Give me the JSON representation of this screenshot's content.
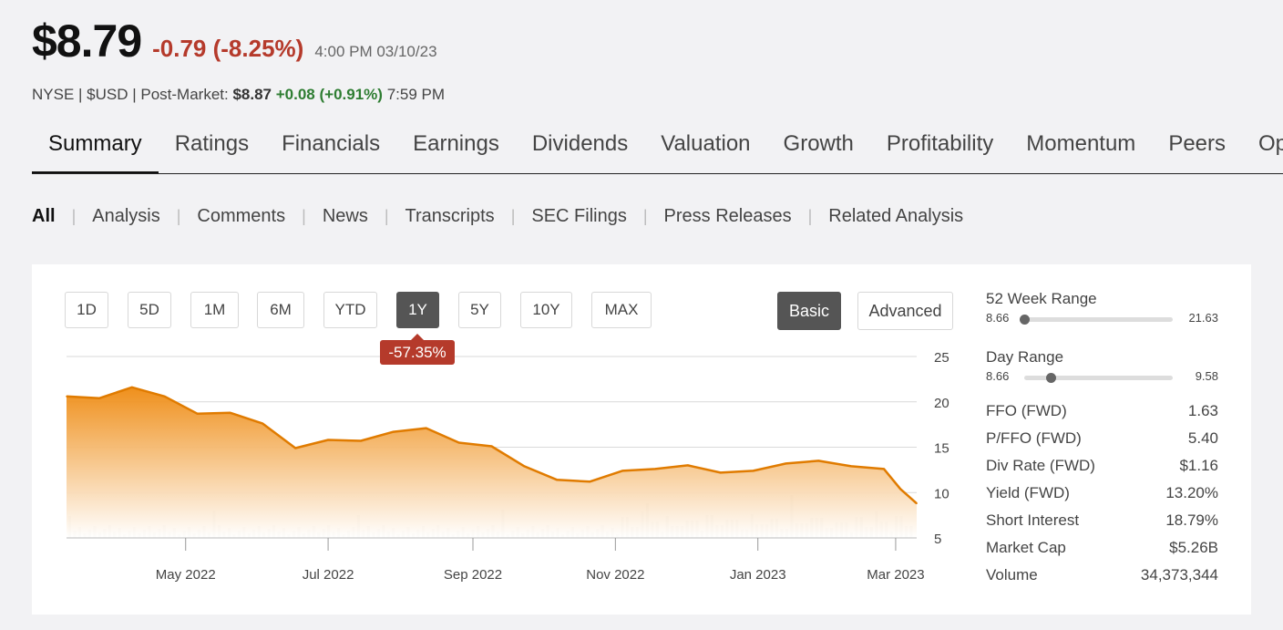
{
  "quote": {
    "price": "$8.79",
    "change": "-0.79 (-8.25%)",
    "time": "4:00 PM 03/10/23",
    "exchange_line": "NYSE | $USD | Post-Market:",
    "post_price": "$8.87",
    "post_change": "+0.08 (+0.91%)",
    "post_time": "7:59 PM"
  },
  "main_tabs": [
    "Summary",
    "Ratings",
    "Financials",
    "Earnings",
    "Dividends",
    "Valuation",
    "Growth",
    "Profitability",
    "Momentum",
    "Peers",
    "Options"
  ],
  "sub_tabs": [
    "All",
    "Analysis",
    "Comments",
    "News",
    "Transcripts",
    "SEC Filings",
    "Press Releases",
    "Related Analysis"
  ],
  "range_buttons": [
    "1D",
    "5D",
    "1M",
    "6M",
    "YTD",
    "1Y",
    "5Y",
    "10Y",
    "MAX"
  ],
  "active_range": "1Y",
  "mode_buttons": [
    "Basic",
    "Advanced"
  ],
  "active_mode": "Basic",
  "performance_badge": "-57.35%",
  "stats": {
    "week52_label": "52 Week Range",
    "week52_low": "8.66",
    "week52_high": "21.63",
    "week52_position": 0.0,
    "day_label": "Day Range",
    "day_low": "8.66",
    "day_high": "9.58",
    "day_position": 0.18,
    "rows": [
      {
        "label": "FFO (FWD)",
        "value": "1.63"
      },
      {
        "label": "P/FFO (FWD)",
        "value": "5.40"
      },
      {
        "label": "Div Rate (FWD)",
        "value": "$1.16"
      },
      {
        "label": "Yield (FWD)",
        "value": "13.20%"
      },
      {
        "label": "Short Interest",
        "value": "18.79%"
      },
      {
        "label": "Market Cap",
        "value": "$5.26B"
      },
      {
        "label": "Volume",
        "value": "34,373,344"
      }
    ]
  },
  "colors": {
    "line": "#e07b00",
    "fill_top": "#ee8a10",
    "negative": "#b53a2b",
    "positive": "#2e7d32",
    "volume": "#cccccc"
  },
  "chart_data": {
    "type": "area",
    "x_tick_labels": [
      "May 2022",
      "Jul 2022",
      "Sep 2022",
      "Nov 2022",
      "Jan 2023",
      "Mar 2023"
    ],
    "x_tick_dates": [
      "2022-05-01",
      "2022-07-01",
      "2022-09-01",
      "2022-11-01",
      "2023-01-01",
      "2023-03-01"
    ],
    "x_range": [
      "2022-03-11",
      "2023-03-10"
    ],
    "y_ticks": [
      25,
      20,
      15,
      10,
      5
    ],
    "ylim": [
      5,
      25
    ],
    "y_axis_side": "right",
    "grid": true,
    "x": [
      "2022-03-11",
      "2022-03-25",
      "2022-04-08",
      "2022-04-22",
      "2022-05-06",
      "2022-05-20",
      "2022-06-03",
      "2022-06-17",
      "2022-07-01",
      "2022-07-15",
      "2022-07-29",
      "2022-08-12",
      "2022-08-26",
      "2022-09-09",
      "2022-09-23",
      "2022-10-07",
      "2022-10-21",
      "2022-11-04",
      "2022-11-18",
      "2022-12-02",
      "2022-12-16",
      "2022-12-30",
      "2023-01-13",
      "2023-01-27",
      "2023-02-10",
      "2023-02-24",
      "2023-03-03",
      "2023-03-10"
    ],
    "series": [
      {
        "values": [
          20.6,
          20.4,
          21.6,
          20.6,
          18.7,
          18.8,
          17.6,
          14.9,
          15.8,
          15.7,
          16.7,
          17.1,
          15.5,
          15.1,
          12.9,
          11.4,
          11.2,
          12.4,
          12.6,
          13.0,
          12.2,
          12.4,
          13.2,
          13.5,
          12.9,
          12.6,
          10.4,
          8.8
        ]
      }
    ]
  }
}
